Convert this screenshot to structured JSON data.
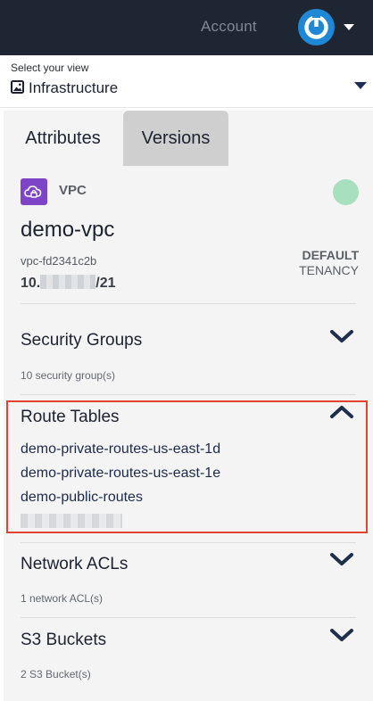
{
  "header": {
    "account_label": "Account"
  },
  "view_selector": {
    "label": "Select your view",
    "value": "Infrastructure"
  },
  "tabs": [
    {
      "label": "Attributes"
    },
    {
      "label": "Versions"
    }
  ],
  "vpc": {
    "type": "VPC",
    "name": "demo-vpc",
    "id": "vpc-fd2341c2b",
    "cidr_prefix": "10.",
    "cidr_suffix": "/21",
    "tenancy_line1": "DEFAULT",
    "tenancy_line2": "TENANCY",
    "status_color": "#a7dfbf"
  },
  "sections": {
    "security_groups": {
      "title": "Security Groups",
      "summary": "10 security group(s)"
    },
    "route_tables": {
      "title": "Route Tables",
      "items": [
        "demo-private-routes-us-east-1d",
        "demo-private-routes-us-east-1e",
        "demo-public-routes"
      ]
    },
    "network_acls": {
      "title": "Network ACLs",
      "summary": "1 network ACL(s)"
    },
    "s3_buckets": {
      "title": "S3 Buckets",
      "summary": "2 S3 Bucket(s)"
    }
  },
  "colors": {
    "topbar": "#1f2633",
    "accent": "#1e87d6",
    "highlight": "#e0442e",
    "vpc_icon": "#7e44c8"
  }
}
